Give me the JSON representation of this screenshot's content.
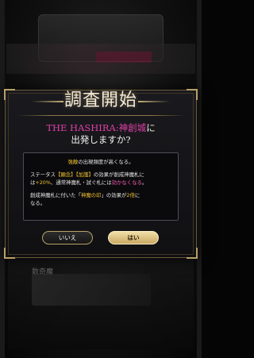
{
  "background": {
    "label": "数奇魔"
  },
  "dialog": {
    "title": "調査開始",
    "target": "THE HASHIRA:神創城",
    "question_suffix": "に",
    "question_line2": "出発しますか?",
    "info": {
      "line1_hl": "強敵",
      "line1_rest": "の出現頻度が高くなる。",
      "line2_pre": "ステータス",
      "line2_hl": "【顕念】【加護】",
      "line2_mid": "の効果が創成神魔札に",
      "line3_pre": "は",
      "line3_hl": "+20%",
      "line3_mid": "、通常神魔札・試ぐ札には",
      "line3_hl2": "効かなくなる",
      "line3_end": "。",
      "line4_pre": "創成神魔札に付いた「",
      "line4_hl": "神魔の印",
      "line4_mid": "」の効果が",
      "line4_hl2": "2倍",
      "line4_end": "に",
      "line5": "なる。"
    },
    "buttons": {
      "no": "いいえ",
      "yes": "はい"
    }
  },
  "colors": {
    "accent_gold": "#b9a06a",
    "highlight_yellow": "#f2c230",
    "highlight_pink": "#e03fa8"
  }
}
